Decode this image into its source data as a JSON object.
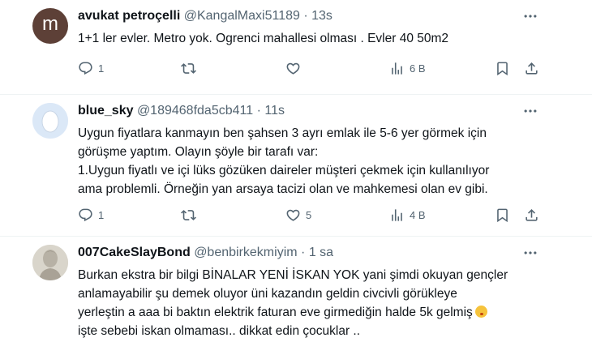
{
  "tweets": [
    {
      "avatar_letter": "m",
      "name": "avukat petroçelli",
      "handle": "@KangalMaxi51189",
      "dot": "·",
      "time": "13s",
      "lines": [
        "1+1 ler evler.  Metro yok. Ogrenci mahallesi olması . Evler 40 50m2"
      ],
      "replies": "1",
      "retweets": "",
      "likes": "",
      "views": "6 B"
    },
    {
      "name": "blue_sky",
      "handle": "@189468fda5cb411",
      "dot": "·",
      "time": "11s",
      "lines": [
        "Uygun fiyatlara kanmayın ben şahsen 3 ayrı emlak ile 5-6 yer görmek için",
        "görüşme yaptım. Olayın şöyle bir tarafı var:",
        "1.Uygun fiyatlı ve içi lüks gözüken daireler müşteri çekmek için kullanılıyor",
        "ama problemli. Örneğin yan arsaya tacizi olan ve mahkemesi olan ev gibi."
      ],
      "replies": "1",
      "retweets": "",
      "likes": "5",
      "views": "4 B"
    },
    {
      "name": "007CakeSlayBond",
      "handle": "@benbirkekmiyim",
      "dot": "·",
      "time": "1 sa",
      "lines": [
        "Burkan ekstra bir bilgi BİNALAR YENİ İSKAN YOK yani şimdi okuyan gençler",
        "anlamayabilir şu demek oluyor üni kazandın geldin civcivli görükleye",
        "yerleştin a aaa bi baktın elektrik faturan eve girmediğin halde 5k gelmiş",
        "işte sebebi iskan olmaması.. dikkat edin çocuklar .."
      ]
    }
  ],
  "icons": {
    "reply": "reply-icon",
    "retweet": "retweet-icon",
    "like": "like-icon",
    "views": "views-icon",
    "bookmark": "bookmark-icon",
    "share": "share-icon",
    "more": "more-icon"
  },
  "colors": {
    "text": "#0f1419",
    "muted": "#536471",
    "divider": "#eff3f4"
  }
}
